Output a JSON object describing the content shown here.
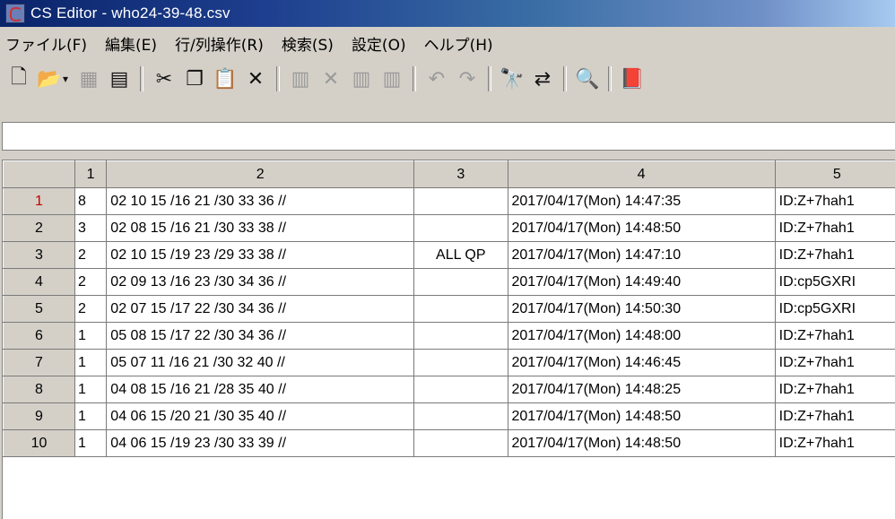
{
  "window": {
    "title": "CS Editor - who24-39-48.csv"
  },
  "menu": {
    "items": [
      "ファイル(F)",
      "編集(E)",
      "行/列操作(R)",
      "検索(S)",
      "設定(O)",
      "ヘルプ(H)"
    ]
  },
  "toolbar": {
    "buttons": [
      {
        "icon": "new-file-icon",
        "glyph": "🗋",
        "enabled": true
      },
      {
        "icon": "open-folder-icon",
        "glyph": "📂",
        "enabled": true
      },
      {
        "icon": "save-icon",
        "glyph": "▦",
        "enabled": false
      },
      {
        "icon": "save-as-icon",
        "glyph": "▤",
        "enabled": true
      },
      {
        "icon": "cut-icon",
        "glyph": "✂",
        "enabled": true
      },
      {
        "icon": "copy-icon",
        "glyph": "❐",
        "enabled": true
      },
      {
        "icon": "paste-icon",
        "glyph": "📋",
        "enabled": true
      },
      {
        "icon": "delete-icon",
        "glyph": "✕",
        "enabled": true
      },
      {
        "icon": "insert-row-icon",
        "glyph": "▥",
        "enabled": false
      },
      {
        "icon": "delete-row-icon",
        "glyph": "✕",
        "enabled": false
      },
      {
        "icon": "insert-column-icon",
        "glyph": "▥",
        "enabled": false
      },
      {
        "icon": "delete-column-icon",
        "glyph": "▥",
        "enabled": false
      },
      {
        "icon": "undo-icon",
        "glyph": "↶",
        "enabled": false
      },
      {
        "icon": "redo-icon",
        "glyph": "↷",
        "enabled": false
      },
      {
        "icon": "find-binoculars-icon",
        "glyph": "🔭",
        "enabled": true
      },
      {
        "icon": "replace-icon",
        "glyph": "⇄",
        "enabled": true
      },
      {
        "icon": "search-magnifier-icon",
        "glyph": "🔍",
        "enabled": true
      },
      {
        "icon": "help-book-icon",
        "glyph": "📕",
        "enabled": true
      }
    ]
  },
  "grid": {
    "column_headers": [
      "1",
      "2",
      "3",
      "4",
      "5"
    ],
    "rows": [
      {
        "num": "1",
        "cells": [
          "8",
          "02 10 15 /16 21 /30 33 36 //",
          "",
          "2017/04/17(Mon) 14:47:35",
          "ID:Z+7hah1"
        ],
        "active": true
      },
      {
        "num": "2",
        "cells": [
          "3",
          "02 08 15 /16 21 /30 33 38 //",
          "",
          "2017/04/17(Mon) 14:48:50",
          "ID:Z+7hah1"
        ]
      },
      {
        "num": "3",
        "cells": [
          "2",
          "02 10 15 /19 23 /29 33 38 //",
          "ALL QP",
          "2017/04/17(Mon) 14:47:10",
          "ID:Z+7hah1"
        ]
      },
      {
        "num": "4",
        "cells": [
          "2",
          "02 09 13 /16 23 /30 34 36 //",
          "",
          "2017/04/17(Mon) 14:49:40",
          "ID:cp5GXRI"
        ]
      },
      {
        "num": "5",
        "cells": [
          "2",
          "02 07 15 /17 22 /30 34 36 //",
          "",
          "2017/04/17(Mon) 14:50:30",
          "ID:cp5GXRI"
        ]
      },
      {
        "num": "6",
        "cells": [
          "1",
          "05 08 15 /17 22 /30 34 36 //",
          "",
          "2017/04/17(Mon) 14:48:00",
          "ID:Z+7hah1"
        ]
      },
      {
        "num": "7",
        "cells": [
          "1",
          "05 07 11 /16 21 /30 32 40 //",
          "",
          "2017/04/17(Mon) 14:46:45",
          "ID:Z+7hah1"
        ]
      },
      {
        "num": "8",
        "cells": [
          "1",
          "04 08 15 /16 21 /28 35 40 //",
          "",
          "2017/04/17(Mon) 14:48:25",
          "ID:Z+7hah1"
        ]
      },
      {
        "num": "9",
        "cells": [
          "1",
          "04 06 15 /20 21 /30 35 40 //",
          "",
          "2017/04/17(Mon) 14:48:50",
          "ID:Z+7hah1"
        ]
      },
      {
        "num": "10",
        "cells": [
          "1",
          "04 06 15 /19 23 /30 33 39 //",
          "",
          "2017/04/17(Mon) 14:48:50",
          "ID:Z+7hah1"
        ]
      }
    ]
  },
  "colors": {
    "active_row_number": "#c00000",
    "title_start": "#0a246a",
    "title_end": "#a6caf0"
  }
}
